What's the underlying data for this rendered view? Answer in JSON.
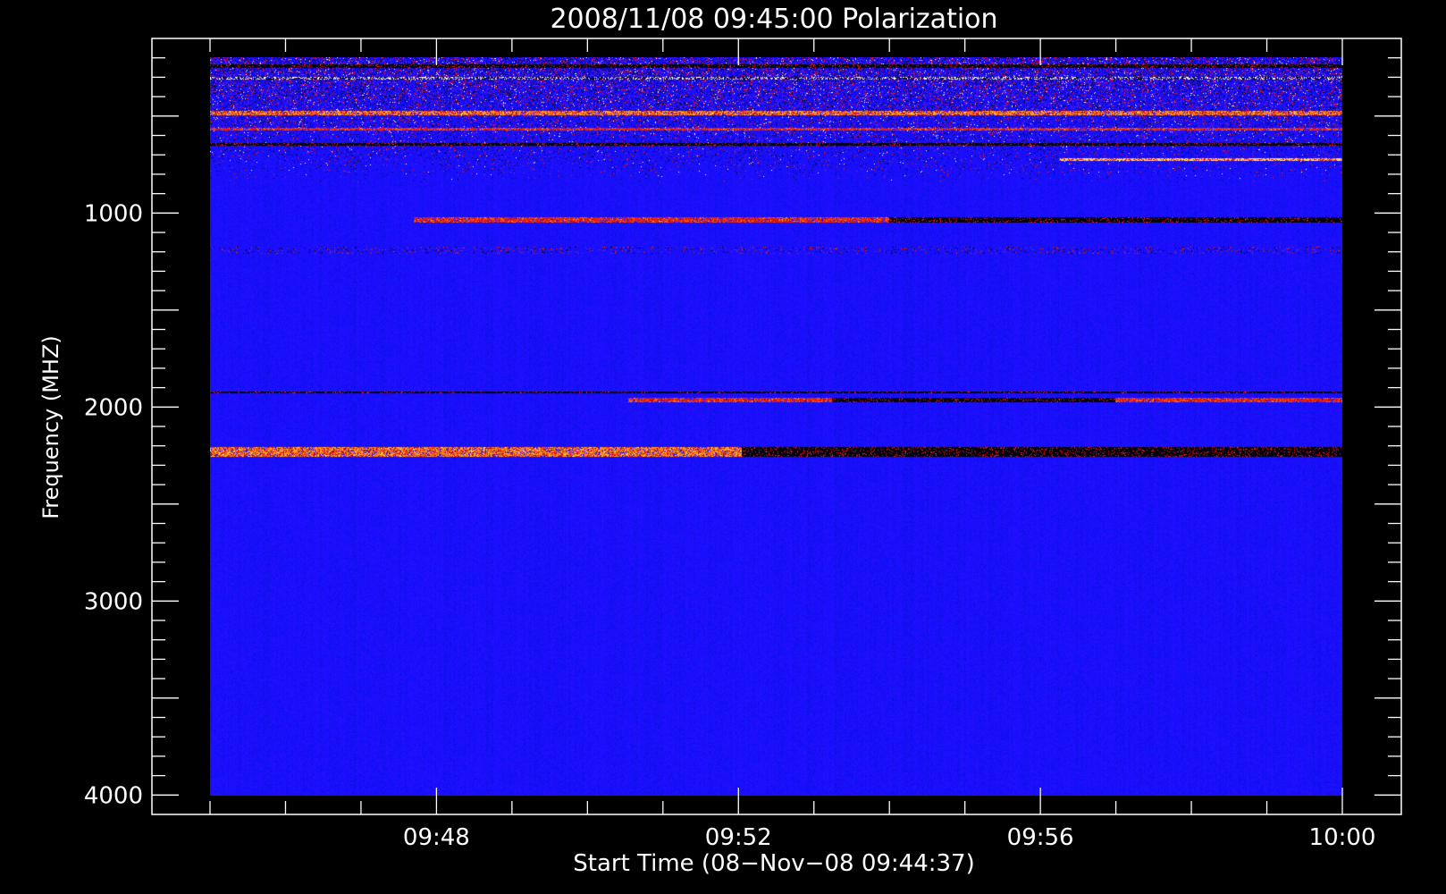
{
  "chart_data": {
    "type": "heatmap",
    "title": "2008/11/08 09:45:00 Polarization",
    "xlabel": "Start Time (08−Nov−08 09:44:37)",
    "ylabel": "Frequency (MHZ)",
    "x_ticks": [
      "09:48",
      "09:52",
      "09:56",
      "10:00"
    ],
    "y_ticks": [
      "1000",
      "2000",
      "3000",
      "4000"
    ],
    "ylim": [
      100,
      4100
    ],
    "y_inverted": true,
    "data_time_range": [
      "09:45:00",
      "10:00:00"
    ],
    "data_freq_range": [
      100,
      4000
    ],
    "grid": false,
    "colors": {
      "background": "#000000",
      "axes": "#ffffff",
      "field": "#1a0fff",
      "dark": "#000010",
      "red": "#e8200a",
      "orange": "#ff8c1a",
      "yellow": "#ffe060"
    },
    "features": [
      {
        "freq": 148,
        "width": 12,
        "t0": 0.0,
        "t1": 1.0,
        "kind": "dark"
      },
      {
        "freq": 212,
        "width": 8,
        "t0": 0.0,
        "t1": 1.0,
        "kind": "mixed"
      },
      {
        "freq": 396,
        "width": 20,
        "t0": 0.0,
        "t1": 1.0,
        "kind": "orange"
      },
      {
        "freq": 480,
        "width": 8,
        "t0": 0.0,
        "t1": 1.0,
        "kind": "red"
      },
      {
        "freq": 560,
        "width": 12,
        "t0": 0.0,
        "t1": 1.0,
        "kind": "dark"
      },
      {
        "freq": 640,
        "width": 8,
        "t0": 0.75,
        "t1": 1.0,
        "kind": "yellow"
      },
      {
        "freq": 960,
        "width": 22,
        "t0": 0.18,
        "t1": 0.6,
        "kind": "red"
      },
      {
        "freq": 960,
        "width": 22,
        "t0": 0.6,
        "t1": 1.0,
        "kind": "dark"
      },
      {
        "freq": 1120,
        "width": 30,
        "t0": 0.0,
        "t1": 1.0,
        "kind": "speckle"
      },
      {
        "freq": 1870,
        "width": 8,
        "t0": 0.0,
        "t1": 1.0,
        "kind": "dark"
      },
      {
        "freq": 1910,
        "width": 16,
        "t0": 0.37,
        "t1": 0.55,
        "kind": "red"
      },
      {
        "freq": 1910,
        "width": 16,
        "t0": 0.55,
        "t1": 0.8,
        "kind": "dark"
      },
      {
        "freq": 1910,
        "width": 16,
        "t0": 0.8,
        "t1": 1.0,
        "kind": "red"
      },
      {
        "freq": 2185,
        "width": 45,
        "t0": 0.0,
        "t1": 0.47,
        "kind": "orange"
      },
      {
        "freq": 2185,
        "width": 45,
        "t0": 0.47,
        "t1": 1.0,
        "kind": "dark"
      }
    ]
  }
}
